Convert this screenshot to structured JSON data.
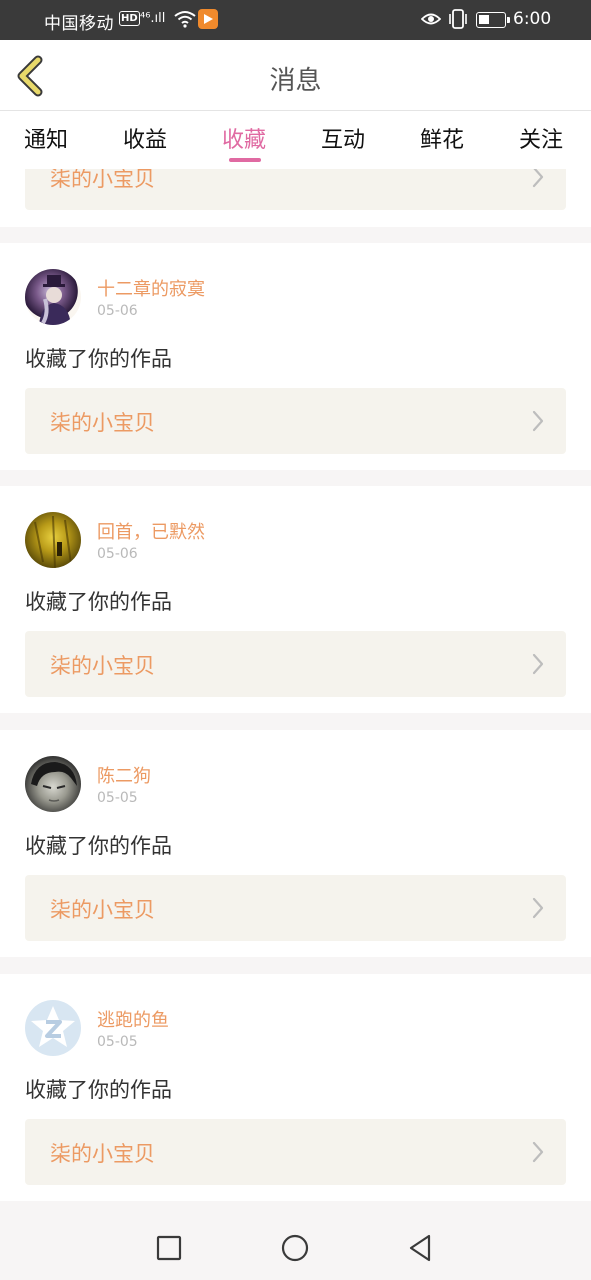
{
  "status_bar": {
    "carrier": "中国移动",
    "hd_badge": "HD",
    "network": "⁴⁶.ıll",
    "time": "6:00",
    "icons": [
      "wifi-icon",
      "app-notification-icon",
      "eye-icon",
      "vibrate-icon",
      "battery-icon"
    ]
  },
  "header": {
    "title": "消息",
    "back_icon": "chevron-left-icon"
  },
  "tabs": [
    {
      "label": "通知",
      "active": false
    },
    {
      "label": "收益",
      "active": false
    },
    {
      "label": "收藏",
      "active": true
    },
    {
      "label": "互动",
      "active": false
    },
    {
      "label": "鲜花",
      "active": false
    },
    {
      "label": "关注",
      "active": false
    }
  ],
  "partial_item": {
    "work_title": "柒的小宝贝"
  },
  "items": [
    {
      "username": "十二章的寂寞",
      "date": "05-06",
      "message": "收藏了你的作品",
      "work_title": "柒的小宝贝"
    },
    {
      "username": "回首，已默然",
      "date": "05-06",
      "message": "收藏了你的作品",
      "work_title": "柒的小宝贝"
    },
    {
      "username": "陈二狗",
      "date": "05-05",
      "message": "收藏了你的作品",
      "work_title": "柒的小宝贝"
    },
    {
      "username": "逃跑的鱼",
      "date": "05-05",
      "message": "收藏了你的作品",
      "work_title": "柒的小宝贝"
    }
  ],
  "colors": {
    "accent_pink": "#e06aa2",
    "username_orange": "#ec9a63",
    "back_arrow": "#e8d96a",
    "link_box_bg": "#f5f3ed"
  },
  "navbar": {
    "buttons": [
      "recent-apps-icon",
      "home-icon",
      "back-icon"
    ]
  }
}
